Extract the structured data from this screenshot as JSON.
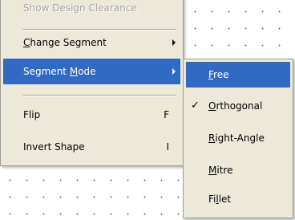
{
  "main_menu": {
    "items": [
      {
        "label": "Show Design Clearance",
        "state": "disabled"
      },
      {
        "label": "Change Segment",
        "underline_index": 0,
        "has_submenu": true
      },
      {
        "label": "Segment Mode",
        "underline_index": 8,
        "has_submenu": true,
        "state": "highlighted"
      },
      {
        "label": "Flip",
        "shortcut": "F"
      },
      {
        "label": "Invert Shape",
        "shortcut": "I"
      }
    ]
  },
  "sub_menu": {
    "items": [
      {
        "label": "Free",
        "underline_index": 0,
        "state": "highlighted"
      },
      {
        "label": "Orthogonal",
        "underline_index": 0,
        "checked": true,
        "check_glyph": "✓"
      },
      {
        "label": "Right-Angle",
        "underline_index": 0
      },
      {
        "label": "Mitre",
        "underline_index": 0
      },
      {
        "label": "Fillet",
        "underline_index": 2
      }
    ]
  },
  "colors": {
    "menu_background": "#ede9d9",
    "highlight": "#316ac5",
    "disabled_text": "#a6a39c",
    "canvas_background": "#ffffff",
    "grid_dot": "#6f6f6f"
  }
}
